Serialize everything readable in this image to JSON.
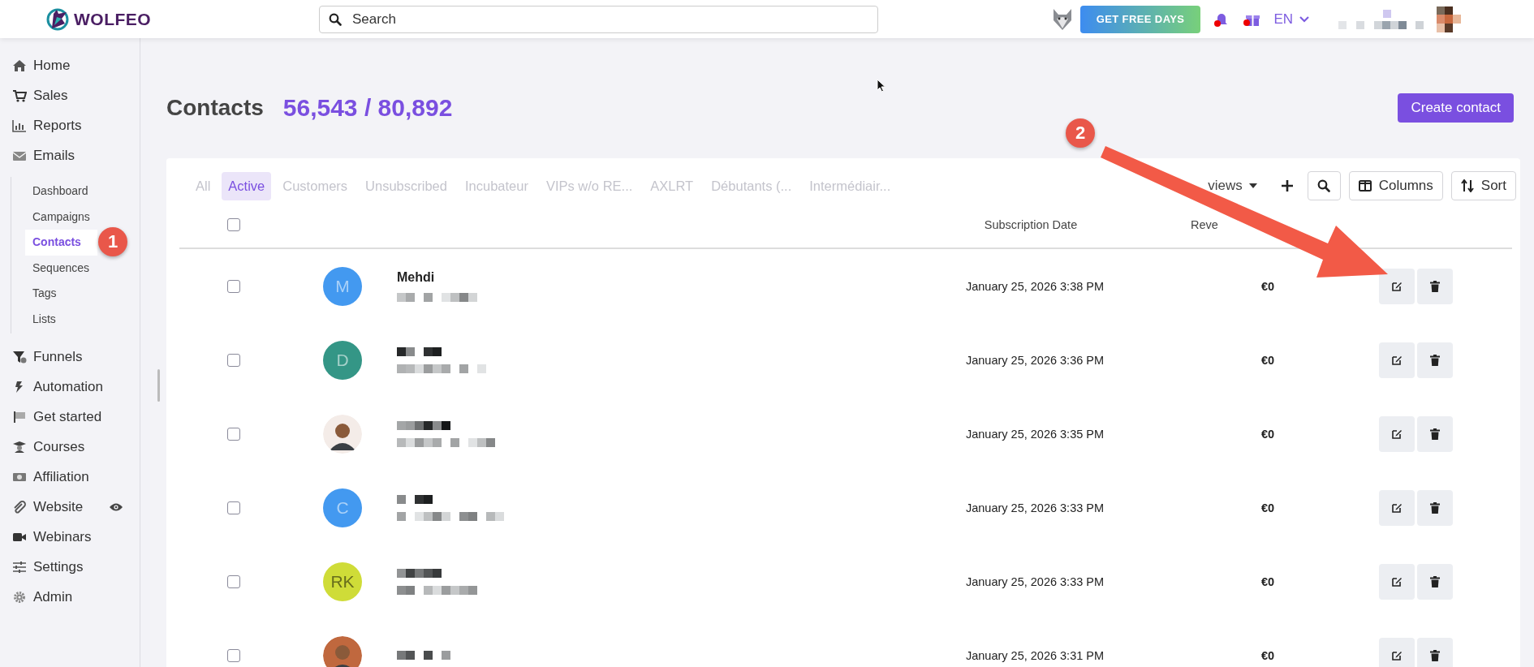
{
  "header": {
    "logo": "WOLFEO",
    "search": {
      "placeholder": "Search"
    },
    "promo_button": "GET FREE DAYS",
    "notification_dot": true,
    "gift_dot": true,
    "language": "EN"
  },
  "sidebar": {
    "items": [
      {
        "label": "Home"
      },
      {
        "label": "Sales"
      },
      {
        "label": "Reports"
      },
      {
        "label": "Emails",
        "children": [
          {
            "label": "Dashboard",
            "selected": false
          },
          {
            "label": "Campaigns",
            "selected": false
          },
          {
            "label": "Contacts",
            "selected": true
          },
          {
            "label": "Sequences",
            "selected": false
          },
          {
            "label": "Tags",
            "selected": false
          },
          {
            "label": "Lists",
            "selected": false
          }
        ]
      },
      {
        "label": "Funnels"
      },
      {
        "label": "Automation"
      },
      {
        "label": "Get started"
      },
      {
        "label": "Courses"
      },
      {
        "label": "Affiliation"
      },
      {
        "label": "Website",
        "visibility_toggle": true
      },
      {
        "label": "Webinars"
      },
      {
        "label": "Settings"
      },
      {
        "label": "Admin"
      }
    ]
  },
  "page": {
    "title": "Contacts",
    "count": "56,543 / 80,892",
    "create_button": "Create contact"
  },
  "filters": [
    {
      "label": "All",
      "selected": false
    },
    {
      "label": "Active",
      "selected": true
    },
    {
      "label": "Customers",
      "selected": false
    },
    {
      "label": "Unsubscribed",
      "selected": false
    },
    {
      "label": "Incubateur",
      "selected": false
    },
    {
      "label": "VIPs w/o RE...",
      "selected": false
    },
    {
      "label": "AXLRT",
      "selected": false
    },
    {
      "label": "Débutants (...",
      "selected": false
    },
    {
      "label": "Intermédiair...",
      "selected": false
    }
  ],
  "toolbar": {
    "views": "views",
    "columns": "Columns",
    "sort": "Sort"
  },
  "table": {
    "columns": [
      "Subscription Date",
      "Reve"
    ],
    "header_checked": false,
    "rows": [
      {
        "name": "Mehdi",
        "avatar": {
          "kind": "initials",
          "text": "M",
          "color": "#4399f0"
        },
        "date": "January 25, 2026 3:38 PM",
        "revenue": "€0",
        "checked": false
      },
      {
        "avatar": {
          "kind": "initials",
          "text": "D",
          "color": "#349686"
        },
        "date": "January 25, 2026 3:36 PM",
        "revenue": "€0",
        "checked": false
      },
      {
        "avatar": {
          "kind": "photo",
          "color": "#f4ece8"
        },
        "date": "January 25, 2026 3:35 PM",
        "revenue": "€0",
        "checked": false
      },
      {
        "avatar": {
          "kind": "initials",
          "text": "C",
          "color": "#4399f0"
        },
        "date": "January 25, 2026 3:33 PM",
        "revenue": "€0",
        "checked": false
      },
      {
        "avatar": {
          "kind": "initials",
          "text": "RK",
          "color": "#cfdc38"
        },
        "date": "January 25, 2026 3:33 PM",
        "revenue": "€0",
        "checked": false
      },
      {
        "avatar": {
          "kind": "photo",
          "color": "#c0683e"
        },
        "date": "January 25, 2026 3:31 PM",
        "revenue": "€0",
        "checked": false
      }
    ]
  },
  "annotations": [
    {
      "text": "1"
    },
    {
      "text": "2"
    }
  ]
}
